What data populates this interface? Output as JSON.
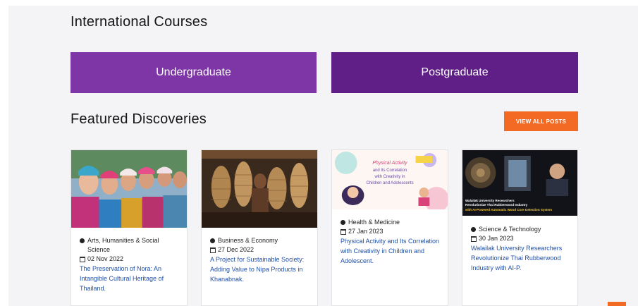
{
  "intl": {
    "title": "International Courses",
    "undergraduate": "Undergraduate",
    "postgraduate": "Postgraduate"
  },
  "featured": {
    "title": "Featured Discoveries",
    "view_all": "VIEW ALL POSTS",
    "posts": [
      {
        "category": "Arts, Humanities & Social Science",
        "date": "02 Nov 2022",
        "title": "The Preservation of Nora: An Intangible Cultural Heritage of Thailand."
      },
      {
        "category": "Business & Economy",
        "date": "27 Dec 2022",
        "title": "A Project for Sustainable Society: Adding Value to Nipa Products in Khanabnak."
      },
      {
        "category": "Health & Medicine",
        "date": "27 Jan 2023",
        "title": "Physical Activity and Its Correlation with Creativity in Children and Adolescent.",
        "image_text": {
          "line1": "Physical Activity",
          "line2": "and Its Correlation",
          "line3": "with Creativity in",
          "line4": "Children and Adolescents"
        }
      },
      {
        "category": "Science & Technology",
        "date": "30 Jan 2023",
        "title": "Walailak University Researchers Revolutionize Thai Rubberwood Industry with AI-P.",
        "image_text": {
          "line1": "Walailak University Researchers",
          "line2": "Revolutionize Thai Rubberwood Industry",
          "line3": "with AI-Powered Automatic Wood Core Detection System"
        }
      }
    ]
  },
  "colors": {
    "undergraduate_bg": "#7e35a6",
    "postgraduate_bg": "#5f1f86",
    "accent_orange": "#f36a24",
    "link_blue": "#1f4fa8"
  }
}
